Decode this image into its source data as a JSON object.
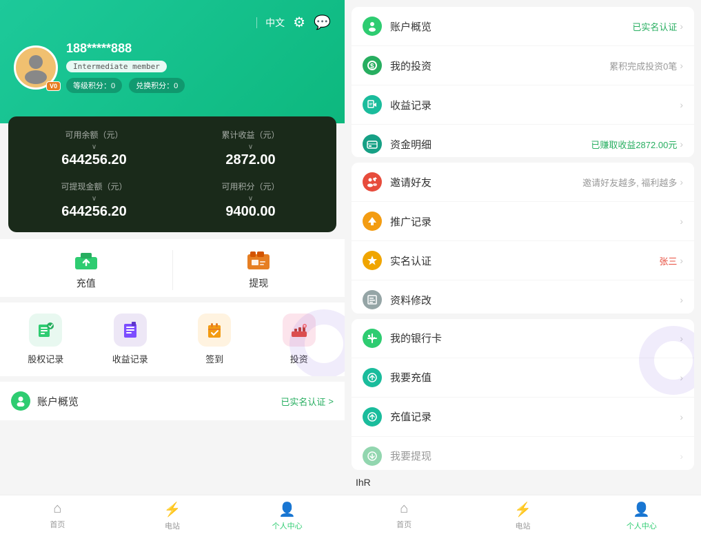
{
  "leftPanel": {
    "header": {
      "language": "中文",
      "username": "188*****888",
      "memberBadge": "Intermediate member",
      "levelPoints": "等级积分：0",
      "exchangePoints": "兑换积分：0",
      "vipLevel": "V0"
    },
    "balance": {
      "availableLabel": "可用余额（元）",
      "cumulativeLabel": "累计收益（元）",
      "withdrawableLabel": "可提现金额（元）",
      "pointsLabel": "可用积分（元）",
      "availableValue": "644256.20",
      "cumulativeValue": "2872.00",
      "withdrawableValue": "644256.20",
      "pointsValue": "9400.00",
      "arrow": "∨"
    },
    "actions": {
      "charge": "充值",
      "withdraw": "提现"
    },
    "quickMenu": {
      "items": [
        {
          "label": "股权记录",
          "color": "green"
        },
        {
          "label": "收益记录",
          "color": "purple"
        },
        {
          "label": "签到",
          "color": "orange"
        },
        {
          "label": "投资",
          "color": "red"
        }
      ]
    },
    "accountOverview": {
      "label": "账户概览",
      "status": "已实名认证",
      "chevron": ">"
    },
    "bottomNav": {
      "items": [
        {
          "label": "首页",
          "active": false
        },
        {
          "label": "电站",
          "active": false
        },
        {
          "label": "个人中心",
          "active": true
        }
      ]
    }
  },
  "rightPanel": {
    "sections": [
      {
        "items": [
          {
            "label": "账户概览",
            "rightText": "已实名认证",
            "rightColor": "green",
            "iconColor": "green"
          },
          {
            "label": "我的投资",
            "rightText": "累积完成投资0笔",
            "rightColor": "gray",
            "iconColor": "green2"
          },
          {
            "label": "收益记录",
            "rightText": "",
            "rightColor": "gray",
            "iconColor": "teal"
          },
          {
            "label": "资金明细",
            "rightText": "已赚取收益2872.00元",
            "rightColor": "green",
            "iconColor": "darkgreen"
          }
        ]
      },
      {
        "items": [
          {
            "label": "邀请好友",
            "rightText": "邀请好友越多, 福利越多",
            "rightColor": "gray",
            "iconColor": "red"
          },
          {
            "label": "推广记录",
            "rightText": "",
            "rightColor": "gray",
            "iconColor": "orange"
          },
          {
            "label": "实名认证",
            "rightText": "张三",
            "rightColor": "red",
            "iconColor": "orange2"
          },
          {
            "label": "资料修改",
            "rightText": "",
            "rightColor": "gray",
            "iconColor": "gray"
          }
        ]
      },
      {
        "items": [
          {
            "label": "我的银行卡",
            "rightText": "",
            "rightColor": "gray",
            "iconColor": "green"
          },
          {
            "label": "我要充值",
            "rightText": "",
            "rightColor": "gray",
            "iconColor": "teal"
          },
          {
            "label": "充值记录",
            "rightText": "",
            "rightColor": "gray",
            "iconColor": "teal"
          },
          {
            "label": "我要提现",
            "rightText": "",
            "rightColor": "gray",
            "iconColor": "green2"
          }
        ]
      }
    ],
    "bottomNav": {
      "items": [
        {
          "label": "首页",
          "active": false
        },
        {
          "label": "电站",
          "active": false
        },
        {
          "label": "个人中心",
          "active": true
        }
      ]
    },
    "ihrText": "IhR"
  }
}
